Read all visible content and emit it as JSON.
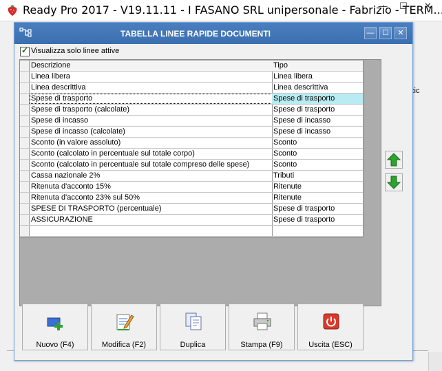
{
  "app": {
    "title": "Ready Pro 2017 - V19.11.11 - I FASANO SRL unipersonale - Fabrizio - TERM...",
    "controls": {
      "minimize": "—",
      "maximize": "☐",
      "close": "✕"
    },
    "background_fragment": "zic"
  },
  "dialog": {
    "title": "TABELLA LINEE RAPIDE DOCUMENTI",
    "controls": {
      "minimize": "—",
      "maximize": "☐",
      "close": "✕"
    },
    "checkbox": {
      "label": "Visualizza solo linee attive",
      "checked": true
    },
    "grid": {
      "columns": [
        "Descrizione",
        "Tipo"
      ],
      "selected_index": 2,
      "rows": [
        {
          "descrizione": "Linea libera",
          "tipo": "Linea libera"
        },
        {
          "descrizione": "Linea descrittiva",
          "tipo": "Linea descrittiva"
        },
        {
          "descrizione": "Spese di trasporto",
          "tipo": "Spese di trasporto"
        },
        {
          "descrizione": "Spese di trasporto (calcolate)",
          "tipo": "Spese di trasporto"
        },
        {
          "descrizione": "Spese di incasso",
          "tipo": "Spese di incasso"
        },
        {
          "descrizione": "Spese di incasso (calcolate)",
          "tipo": "Spese di incasso"
        },
        {
          "descrizione": "Sconto (in valore assoluto)",
          "tipo": "Sconto"
        },
        {
          "descrizione": "Sconto (calcolato in percentuale sul totale corpo)",
          "tipo": "Sconto"
        },
        {
          "descrizione": "Sconto (calcolato in percentuale sul totale compreso delle spese)",
          "tipo": "Sconto"
        },
        {
          "descrizione": "Cassa nazionale 2%",
          "tipo": "Tributi"
        },
        {
          "descrizione": "Ritenuta d'acconto 15%",
          "tipo": "Ritenute"
        },
        {
          "descrizione": "Ritenuta d'acconto 23% sul 50%",
          "tipo": "Ritenute"
        },
        {
          "descrizione": "SPESE DI TRASPORTO (percentuale)",
          "tipo": "Spese di trasporto"
        },
        {
          "descrizione": "ASSICURAZIONE",
          "tipo": "Spese di trasporto"
        },
        {
          "descrizione": "",
          "tipo": ""
        }
      ]
    },
    "side_buttons": {
      "up_icon": "green-up-arrow-icon",
      "down_icon": "green-down-arrow-icon"
    },
    "toolbar": [
      {
        "id": "nuovo",
        "label": "Nuovo (F4)",
        "icon": "new-record-icon"
      },
      {
        "id": "modifica",
        "label": "Modifica (F2)",
        "icon": "edit-document-icon"
      },
      {
        "id": "duplica",
        "label": "Duplica",
        "icon": "duplicate-icon"
      },
      {
        "id": "stampa",
        "label": "Stampa (F9)",
        "icon": "printer-icon"
      },
      {
        "id": "uscita",
        "label": "Uscita (ESC)",
        "icon": "power-exit-icon"
      }
    ],
    "colors": {
      "titlebar": "#4a7fbf",
      "selection": "#b8ecf2",
      "arrow": "#2ea32e",
      "exit": "#d93a2b"
    }
  }
}
